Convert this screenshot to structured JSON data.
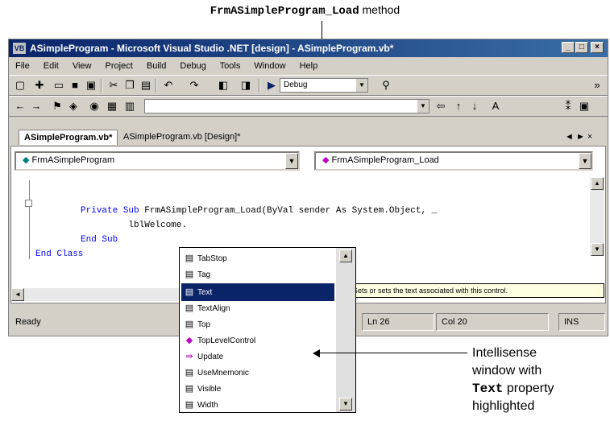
{
  "annotations": {
    "top": {
      "code": "FrmASimpleProgram_Load",
      "text": "method"
    },
    "right": {
      "line1": "Intellisense",
      "line2": "window with",
      "code": "Text",
      "line3": "property",
      "line4": "highlighted"
    }
  },
  "window": {
    "title": "ASimpleProgram - Microsoft Visual Studio .NET [design] - ASimpleProgram.vb*",
    "icon_label": "VB",
    "controls": {
      "minimize": "_",
      "maximize": "□",
      "close": "×"
    }
  },
  "menubar": [
    "File",
    "Edit",
    "View",
    "Project",
    "Build",
    "Debug",
    "Tools",
    "Window",
    "Help"
  ],
  "toolbar": {
    "config_combo": "Debug",
    "nav_combo": ""
  },
  "tabs": [
    {
      "label": "ASimpleProgram.vb*",
      "active": true
    },
    {
      "label": "ASimpleProgram.vb [Design]*",
      "active": false
    }
  ],
  "tab_controls": "◄ ► ×",
  "editor": {
    "class_dropdown": "FrmASimpleProgram",
    "method_dropdown": "FrmASimpleProgram_Load",
    "code": [
      {
        "kw1": "Private Sub",
        "rest": " FrmASimpleProgram_Load(ByVal sender As System.Object, _"
      },
      {
        "kw1": "",
        "rest": "         lblWelcome."
      },
      {
        "kw1": "End Sub",
        "rest": ""
      },
      {
        "kw1": "End Class",
        "rest": ""
      }
    ]
  },
  "tooltip": "Gets or sets the text associated with this control.",
  "statusbar": {
    "ready": "Ready",
    "ln": "Ln 26",
    "col": "Col 20",
    "ins": "INS"
  },
  "intellisense": {
    "items": [
      {
        "label": "TabStop",
        "icon": "property"
      },
      {
        "label": "Tag",
        "icon": "property"
      },
      {
        "label": "Text",
        "icon": "property",
        "selected": true
      },
      {
        "label": "TextAlign",
        "icon": "property"
      },
      {
        "label": "Top",
        "icon": "property"
      },
      {
        "label": "TopLevelControl",
        "icon": "method"
      },
      {
        "label": "Update",
        "icon": "method"
      },
      {
        "label": "UseMnemonic",
        "icon": "property"
      },
      {
        "label": "Visible",
        "icon": "property"
      },
      {
        "label": "Width",
        "icon": "property"
      }
    ]
  }
}
